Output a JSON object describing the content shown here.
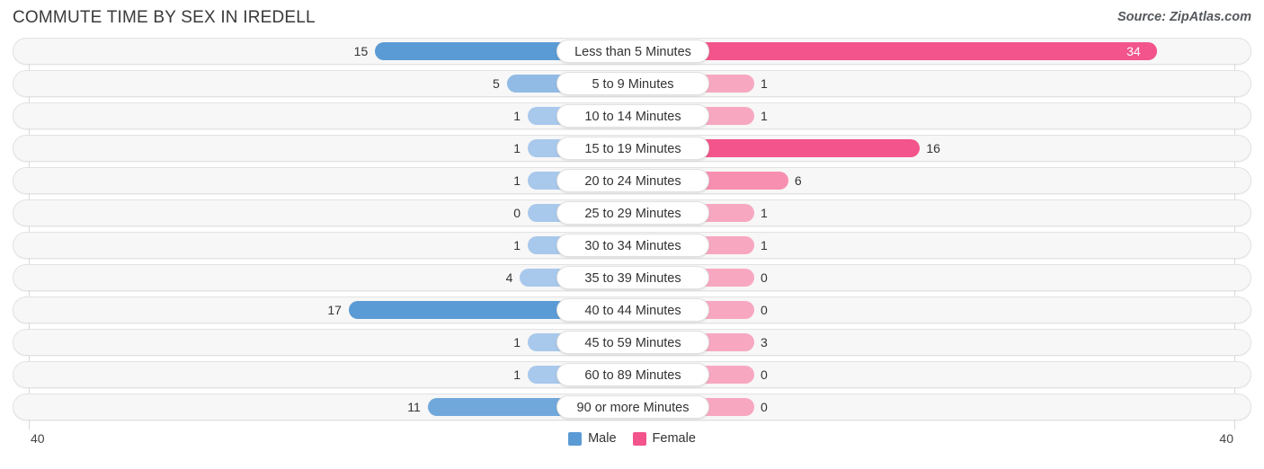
{
  "header": {
    "title": "COMMUTE TIME BY SEX IN IREDELL",
    "source": "Source: ZipAtlas.com"
  },
  "legend": {
    "male_label": "Male",
    "female_label": "Female",
    "male_color": "#5b9bd5",
    "female_color": "#f2548b"
  },
  "axis": {
    "left_label": "40",
    "right_label": "40",
    "max": 40
  },
  "colors": {
    "male_strong": "#5b9bd5",
    "male_light": "#a8c8ec",
    "female_strong": "#f2548b",
    "female_light": "#f7a8c0",
    "row_track": "#f7f7f7",
    "row_border": "#e2e2e2",
    "gridline": "#d9d9d9"
  },
  "chart_data": {
    "type": "bar",
    "title": "COMMUTE TIME BY SEX IN IREDELL",
    "orientation": "horizontal-diverging",
    "xlabel": "",
    "ylabel": "",
    "xlim": [
      40,
      40
    ],
    "grid": true,
    "legend_position": "bottom-center",
    "categories": [
      "Less than 5 Minutes",
      "5 to 9 Minutes",
      "10 to 14 Minutes",
      "15 to 19 Minutes",
      "20 to 24 Minutes",
      "25 to 29 Minutes",
      "30 to 34 Minutes",
      "35 to 39 Minutes",
      "40 to 44 Minutes",
      "45 to 59 Minutes",
      "60 to 89 Minutes",
      "90 or more Minutes"
    ],
    "series": [
      {
        "name": "Male",
        "color": "#5b9bd5",
        "values": [
          15,
          5,
          1,
          1,
          1,
          0,
          1,
          4,
          17,
          1,
          1,
          11
        ]
      },
      {
        "name": "Female",
        "color": "#f2548b",
        "values": [
          34,
          1,
          1,
          16,
          6,
          1,
          1,
          0,
          0,
          3,
          0,
          0
        ]
      }
    ]
  },
  "rows": [
    {
      "label": "Less than 5 Minutes",
      "male": 15,
      "female": 34,
      "male_text": "15",
      "female_text": "34"
    },
    {
      "label": "5 to 9 Minutes",
      "male": 5,
      "female": 1,
      "male_text": "5",
      "female_text": "1"
    },
    {
      "label": "10 to 14 Minutes",
      "male": 1,
      "female": 1,
      "male_text": "1",
      "female_text": "1"
    },
    {
      "label": "15 to 19 Minutes",
      "male": 1,
      "female": 16,
      "male_text": "1",
      "female_text": "16"
    },
    {
      "label": "20 to 24 Minutes",
      "male": 1,
      "female": 6,
      "male_text": "1",
      "female_text": "6"
    },
    {
      "label": "25 to 29 Minutes",
      "male": 0,
      "female": 1,
      "male_text": "0",
      "female_text": "1"
    },
    {
      "label": "30 to 34 Minutes",
      "male": 1,
      "female": 1,
      "male_text": "1",
      "female_text": "1"
    },
    {
      "label": "35 to 39 Minutes",
      "male": 4,
      "female": 0,
      "male_text": "4",
      "female_text": "0"
    },
    {
      "label": "40 to 44 Minutes",
      "male": 17,
      "female": 0,
      "male_text": "17",
      "female_text": "0"
    },
    {
      "label": "45 to 59 Minutes",
      "male": 1,
      "female": 3,
      "male_text": "1",
      "female_text": "3"
    },
    {
      "label": "60 to 89 Minutes",
      "male": 1,
      "female": 0,
      "male_text": "1",
      "female_text": "0"
    },
    {
      "label": "90 or more Minutes",
      "male": 11,
      "female": 0,
      "male_text": "11",
      "female_text": "0"
    }
  ]
}
